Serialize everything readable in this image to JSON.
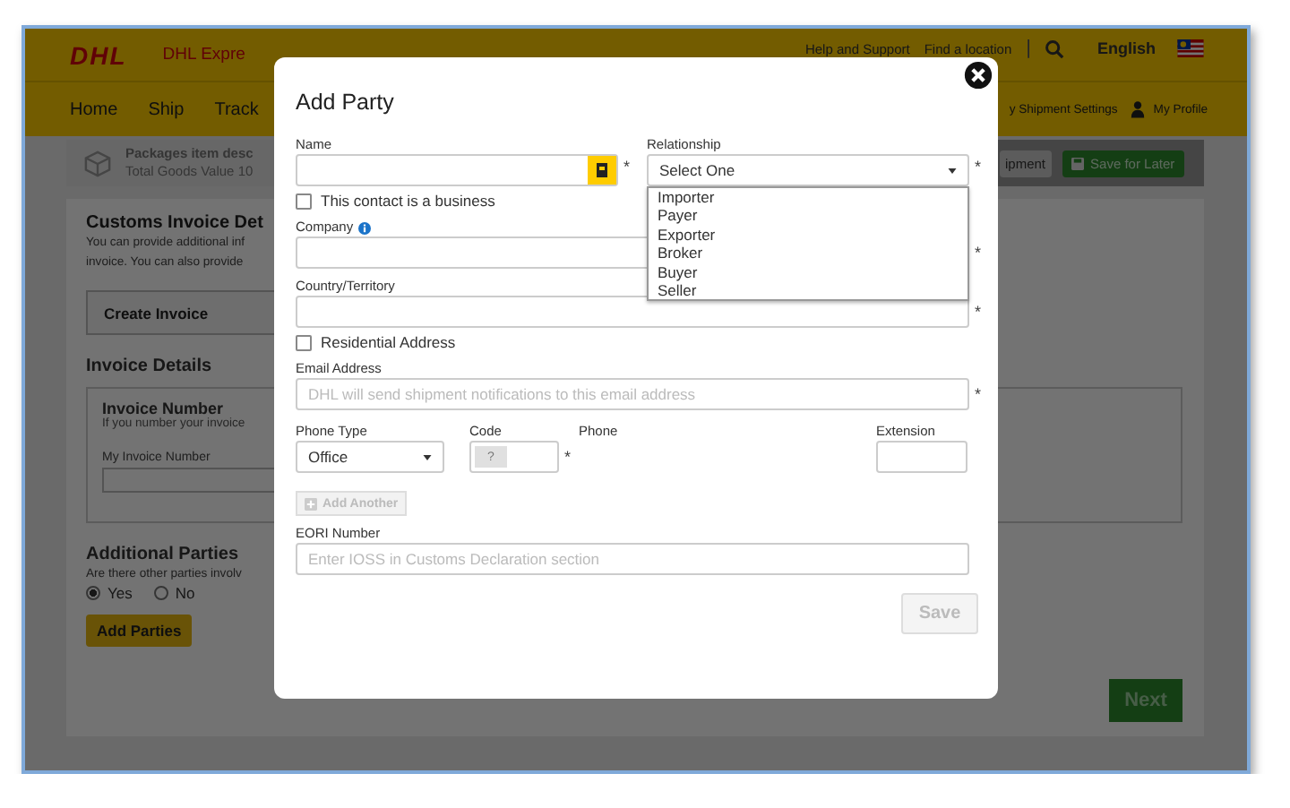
{
  "background_page": {
    "header": {
      "logo": "DHL",
      "brand": "DHL Expre",
      "links": [
        "Help and Support",
        "Find a location"
      ],
      "separator": "|",
      "language": "English"
    },
    "nav": {
      "items": [
        "Home",
        "Ship",
        "Track"
      ],
      "settings": "y Shipment Settings",
      "profile": "My Profile"
    },
    "package_summary": {
      "line_1": "Packages item desc",
      "line_2": "Total Goods Value 10"
    },
    "actions": [
      {
        "label": "ipment",
        "kind": "plain"
      },
      {
        "label": "Save for Later",
        "kind": "save"
      }
    ],
    "invoice_card": {
      "title": "Customs Invoice Det",
      "description": [
        "You can provide additional inf",
        "invoice. You can also provide"
      ],
      "create_button": "Create Invoice",
      "details_heading": "Invoice Details",
      "invoice_number_title": "Invoice Number",
      "invoice_number_hint": "If you number your invoice",
      "invoice_number_label": "My Invoice Number",
      "parties_heading": "Additional Parties",
      "parties_question": "Are there other parties involv",
      "parties_options": [
        {
          "label": "Yes",
          "selected": true
        },
        {
          "label": "No",
          "selected": false
        }
      ],
      "add_parties_button": "Add Parties",
      "next_button": "Next"
    }
  },
  "dialog": {
    "title": "Add Party",
    "name": {
      "label": "Name",
      "marker": "*"
    },
    "relationship": {
      "label": "Relationship",
      "value": "Select One",
      "marker": "*",
      "expanded": true,
      "options": [
        "Importer",
        "Payer",
        "Exporter",
        "Broker",
        "Buyer",
        "Seller"
      ]
    },
    "business_checkbox": {
      "label": "This contact is a business",
      "checked": false
    },
    "company": {
      "label": "Company",
      "marker": "*"
    },
    "country": {
      "label": "Country/Territory",
      "marker": "*"
    },
    "residential_checkbox": {
      "label": "Residential Address",
      "checked": false
    },
    "email": {
      "label": "Email Address",
      "placeholder": "DHL will send shipment notifications to this email address",
      "marker": "*"
    },
    "phone_type": {
      "label": "Phone Type",
      "value": "Office"
    },
    "code": {
      "label": "Code",
      "prefix": "?",
      "marker": "*"
    },
    "phone": {
      "label": "Phone"
    },
    "extension": {
      "label": "Extension"
    },
    "add_another": {
      "label": "Add Another",
      "disabled": true
    },
    "eori": {
      "label": "EORI Number",
      "placeholder": "Enter IOSS in Customs Declaration section"
    },
    "save": {
      "label": "Save",
      "disabled": true
    }
  }
}
